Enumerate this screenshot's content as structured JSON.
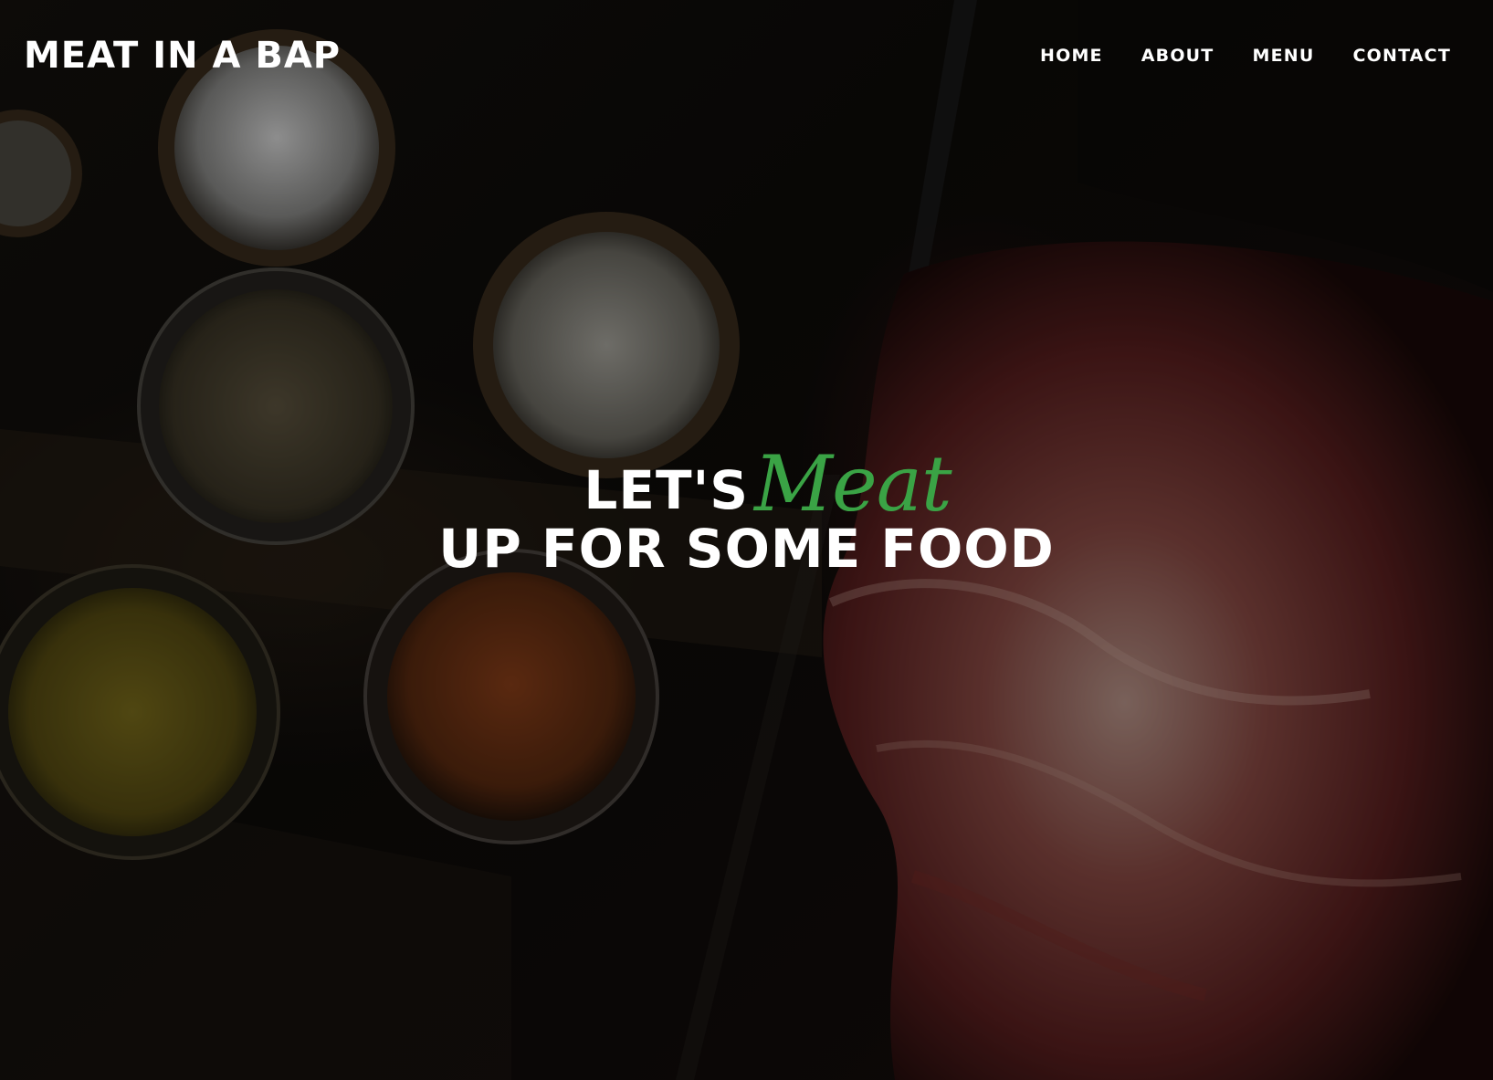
{
  "brand": {
    "name": "MEAT IN A BAP"
  },
  "nav": {
    "items": [
      {
        "label": "HOME"
      },
      {
        "label": "ABOUT"
      },
      {
        "label": "MENU"
      },
      {
        "label": "CONTACT"
      }
    ]
  },
  "hero": {
    "headline_part1": "LET'S",
    "headline_accent": "Meat",
    "headline_line2": "UP FOR SOME FOOD",
    "accent_color": "#3aa345",
    "background_image": "spice-bowls-and-raw-meat-photo"
  }
}
